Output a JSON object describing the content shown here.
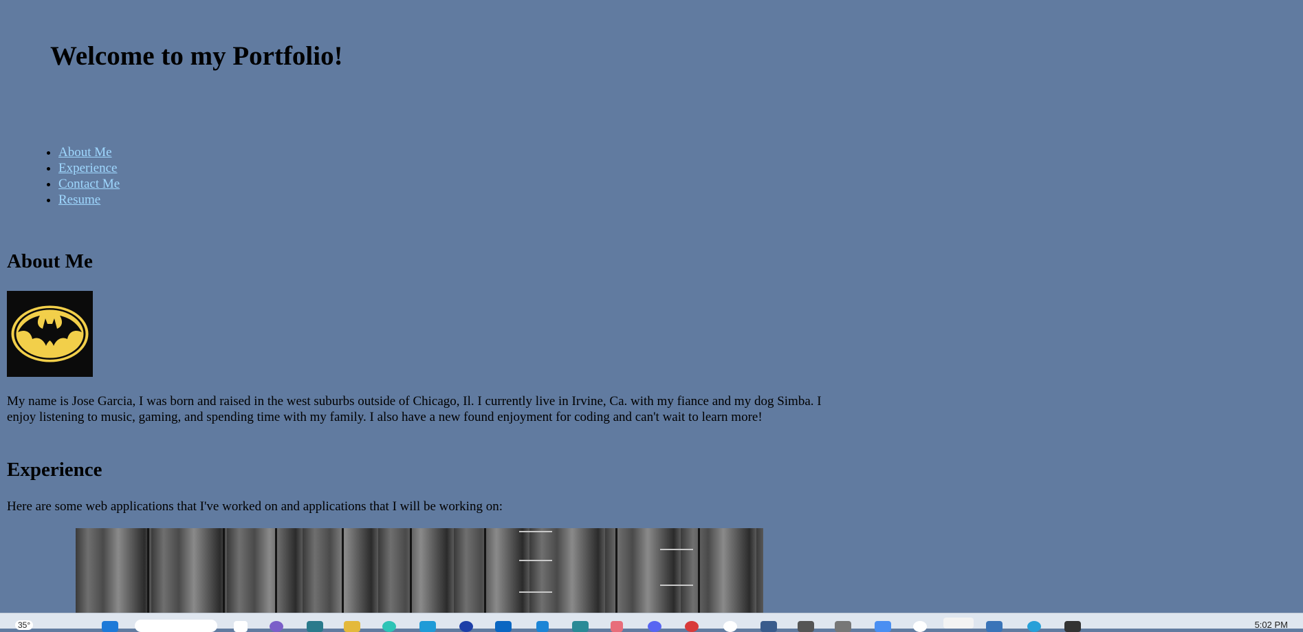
{
  "header": {
    "title": "Welcome to my Portfolio!"
  },
  "nav": {
    "items": [
      {
        "label": "About Me"
      },
      {
        "label": "Experience"
      },
      {
        "label": "Contact Me"
      },
      {
        "label": "Resume"
      }
    ]
  },
  "about": {
    "heading": "About Me",
    "image": "batman-logo",
    "text": "My name is Jose Garcia, I was born and raised in the west suburbs outside of Chicago, Il. I currently live in Irvine, Ca. with my fiance and my dog Simba. I enjoy listening to music, gaming, and spending time with my family. I also have a new found enjoyment for coding and can't wait to learn more!"
  },
  "experience": {
    "heading": "Experience",
    "text": "Here are some web applications that I've worked on and applications that I will be working on:",
    "image": "guitar-on-wood"
  },
  "taskbar": {
    "temperature": "35°",
    "time": "5:02 PM"
  },
  "colors": {
    "background": "#617ba0",
    "link": "#9fd8ff",
    "logo_yellow": "#f2cf4a"
  }
}
